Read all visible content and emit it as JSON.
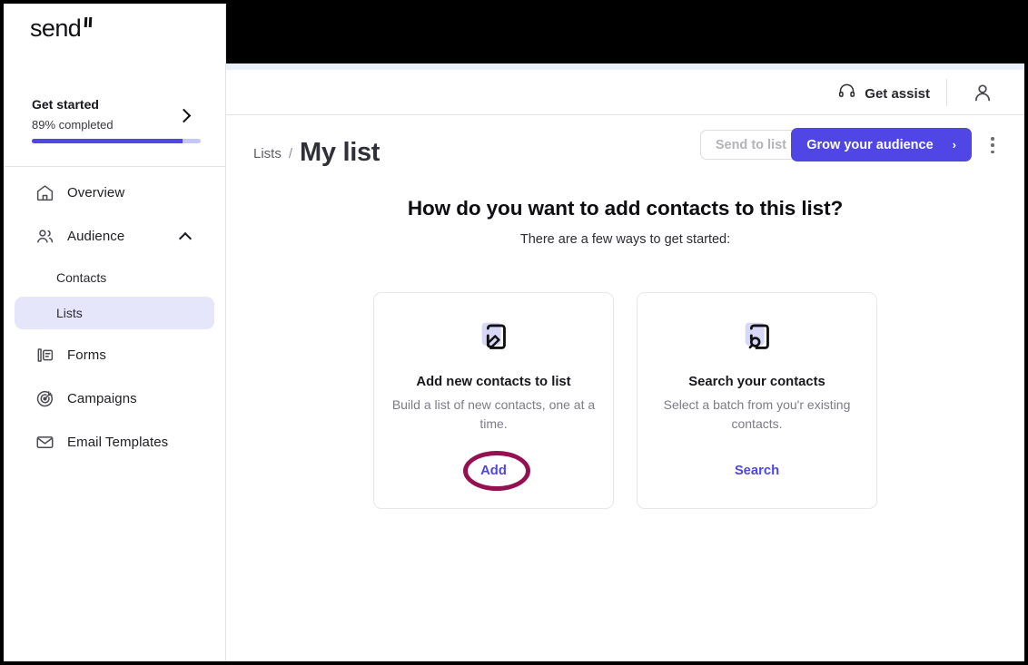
{
  "brand": {
    "logo_text": "send",
    "accent_color": "#4f46e5",
    "annotation_color": "#951050"
  },
  "sidebar": {
    "get_started": {
      "title": "Get started",
      "progress_label": "89% completed",
      "progress_percent": 89,
      "chevron_icon": "chevron-right-icon"
    },
    "items": [
      {
        "label": "Overview",
        "icon": "home-icon",
        "active": false
      },
      {
        "label": "Audience",
        "icon": "users-icon",
        "active": false,
        "expanded": true,
        "caret_icon": "chevron-up-icon"
      },
      {
        "label": "Contacts",
        "icon": "",
        "active": false,
        "sub": true
      },
      {
        "label": "Lists",
        "icon": "",
        "active": true,
        "sub": true
      },
      {
        "label": "Forms",
        "icon": "form-icon",
        "active": false
      },
      {
        "label": "Campaigns",
        "icon": "target-icon",
        "active": false
      },
      {
        "label": "Email Templates",
        "icon": "envelope-icon",
        "active": false
      }
    ]
  },
  "header": {
    "get_assist_label": "Get assist",
    "get_assist_icon": "headset-icon",
    "avatar_icon": "user-avatar-icon"
  },
  "title_row": {
    "breadcrumb_parent": "Lists",
    "breadcrumb_separator": "/",
    "page_title": "My list",
    "send_to_list_label": "Send to list",
    "grow_audience_label": "Grow your audience",
    "grow_audience_arrow": "›",
    "kebab_icon": "more-vertical-icon"
  },
  "main": {
    "heading": "How do you want to add contacts to this list?",
    "subheading": "There are a few ways to get started:",
    "cards": [
      {
        "icon": "note-edit-icon",
        "title": "Add new contacts to list",
        "description": "Build a list of new contacts, one at a time.",
        "action_label": "Add",
        "highlighted": true
      },
      {
        "icon": "note-search-icon",
        "title": "Search your contacts",
        "description": "Select a batch from you'r existing contacts.",
        "action_label": "Search",
        "highlighted": false
      }
    ]
  }
}
